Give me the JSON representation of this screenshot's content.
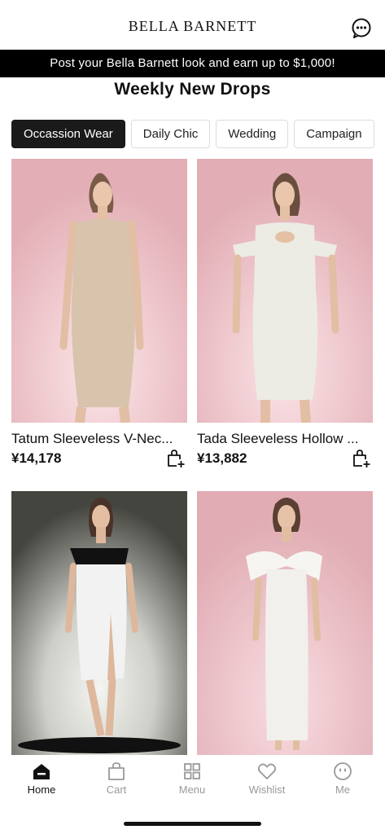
{
  "header": {
    "brand": "BELLA BARNETT",
    "chat_icon": "chat-bubble-icon"
  },
  "promo": {
    "text": "Post your Bella Barnett look and earn up to $1,000!"
  },
  "section": {
    "title": "Weekly New Drops"
  },
  "chips": [
    {
      "label": "Occassion Wear",
      "active": true
    },
    {
      "label": "Daily Chic",
      "active": false
    },
    {
      "label": "Wedding",
      "active": false
    },
    {
      "label": "Campaign",
      "active": false
    }
  ],
  "products": [
    {
      "name": "Tatum Sleeveless V-Nec...",
      "price": "¥14,178",
      "dress_color": "#d8c3ad",
      "bg": "#e6b9bf"
    },
    {
      "name": "Tada Sleeveless Hollow ...",
      "price": "¥13,882",
      "dress_color": "#ecebe4",
      "bg": "#e9b8c0"
    },
    {
      "name": "",
      "price": "",
      "dress_color": "#f2f2f2",
      "bg": "#4a4a46"
    },
    {
      "name": "",
      "price": "",
      "dress_color": "#f1f0ec",
      "bg": "#e7b7be"
    }
  ],
  "tabbar": {
    "items": [
      {
        "label": "Home",
        "icon": "home-icon",
        "active": true
      },
      {
        "label": "Cart",
        "icon": "shopping-bag-icon",
        "active": false
      },
      {
        "label": "Menu",
        "icon": "grid-menu-icon",
        "active": false
      },
      {
        "label": "Wishlist",
        "icon": "heart-icon",
        "active": false
      },
      {
        "label": "Me",
        "icon": "face-icon",
        "active": false
      }
    ]
  }
}
